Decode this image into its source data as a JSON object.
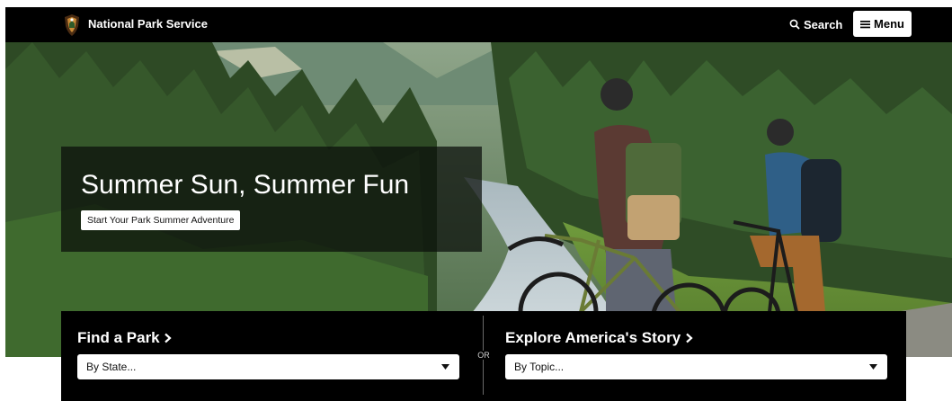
{
  "header": {
    "site_name": "National Park Service",
    "search_label": "Search",
    "menu_label": "Menu",
    "icons": {
      "logo": "nps-arrowhead-icon",
      "search": "search-icon",
      "menu": "hamburger-icon"
    }
  },
  "hero": {
    "title": "Summer Sun, Summer Fun",
    "cta_label": "Start Your Park Summer Adventure"
  },
  "finder": {
    "park": {
      "heading": "Find a Park",
      "select_value": "By State..."
    },
    "or_label": "OR",
    "story": {
      "heading": "Explore America's Story",
      "select_value": "By Topic..."
    }
  },
  "colors": {
    "header_bg": "#000000",
    "finder_bg": "#000000",
    "overlay_bg": "rgba(10,14,10,0.72)",
    "text_light": "#ffffff",
    "forest_green": "#2d4a23"
  }
}
